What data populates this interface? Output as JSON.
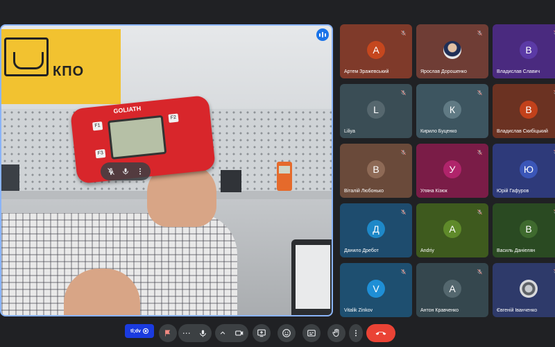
{
  "main_video": {
    "logo_text": "КПО",
    "device_brand": "GOLIATH",
    "device_keys": [
      "F1",
      "F2",
      "F3"
    ]
  },
  "live_badge": {
    "label": "tl;dv"
  },
  "participants": [
    {
      "name": "Артем Зражевський",
      "initial": "А",
      "bg": "#7f3a2a",
      "avatar": "#c5471e",
      "mic_muted": true
    },
    {
      "name": "Ярослав Дорошенко",
      "initial": "",
      "bg": "#6f3d35",
      "avatar": "photo",
      "mic_muted": true
    },
    {
      "name": "Владислав Славич",
      "initial": "В",
      "bg": "#4a2a7f",
      "avatar": "#5b3aa6",
      "mic_muted": true
    },
    {
      "name": "Liliya",
      "initial": "L",
      "bg": "#3a4d55",
      "avatar": "#56676e",
      "mic_muted": true
    },
    {
      "name": "Кирило Буценко",
      "initial": "К",
      "bg": "#3d5560",
      "avatar": "#607a84",
      "mic_muted": true
    },
    {
      "name": "Владислав Скибіцький",
      "initial": "В",
      "bg": "#6b3222",
      "avatar": "#c2411b",
      "mic_muted": true
    },
    {
      "name": "Віталій Любонько",
      "initial": "В",
      "bg": "#6a4a3a",
      "avatar": "#8e6a56",
      "mic_muted": true
    },
    {
      "name": "Уляна Кізюк",
      "initial": "У",
      "bg": "#7a1c47",
      "avatar": "#b0246b",
      "mic_muted": true
    },
    {
      "name": "Юрій Гафуров",
      "initial": "Ю",
      "bg": "#2e3a7a",
      "avatar": "#3b56b8",
      "mic_muted": true
    },
    {
      "name": "Данило Дребот",
      "initial": "Д",
      "bg": "#1e4c6e",
      "avatar": "#1e88c8",
      "mic_muted": true
    },
    {
      "name": "Andriy",
      "initial": "A",
      "bg": "#3e5a1e",
      "avatar": "#5f8a2a",
      "mic_muted": true
    },
    {
      "name": "Василь Даніелян",
      "initial": "В",
      "bg": "#2a4a22",
      "avatar": "#3f6a2e",
      "mic_muted": true
    },
    {
      "name": "Vitalik Zinkov",
      "initial": "V",
      "bg": "#1e4f70",
      "avatar": "#1f8fd6",
      "mic_muted": true
    },
    {
      "name": "Антон Кравченко",
      "initial": "А",
      "bg": "#35474e",
      "avatar": "#54676e",
      "mic_muted": true
    },
    {
      "name": "Євгеній Іванченко",
      "initial": "",
      "bg": "#2e3a6a",
      "avatar": "photo2",
      "mic_muted": true
    }
  ],
  "controls": {
    "more_options": "⋯",
    "microphone": "mic",
    "camera": "camera",
    "present": "present",
    "reactions": "emoji",
    "captions": "captions",
    "raise_hand": "hand",
    "more": "more",
    "leave": "call-end"
  },
  "colors": {
    "background": "#202124",
    "active_border": "#8ab4f8",
    "control_bg": "#3c4043",
    "hangup": "#ea4335",
    "accent": "#1a73e8"
  }
}
